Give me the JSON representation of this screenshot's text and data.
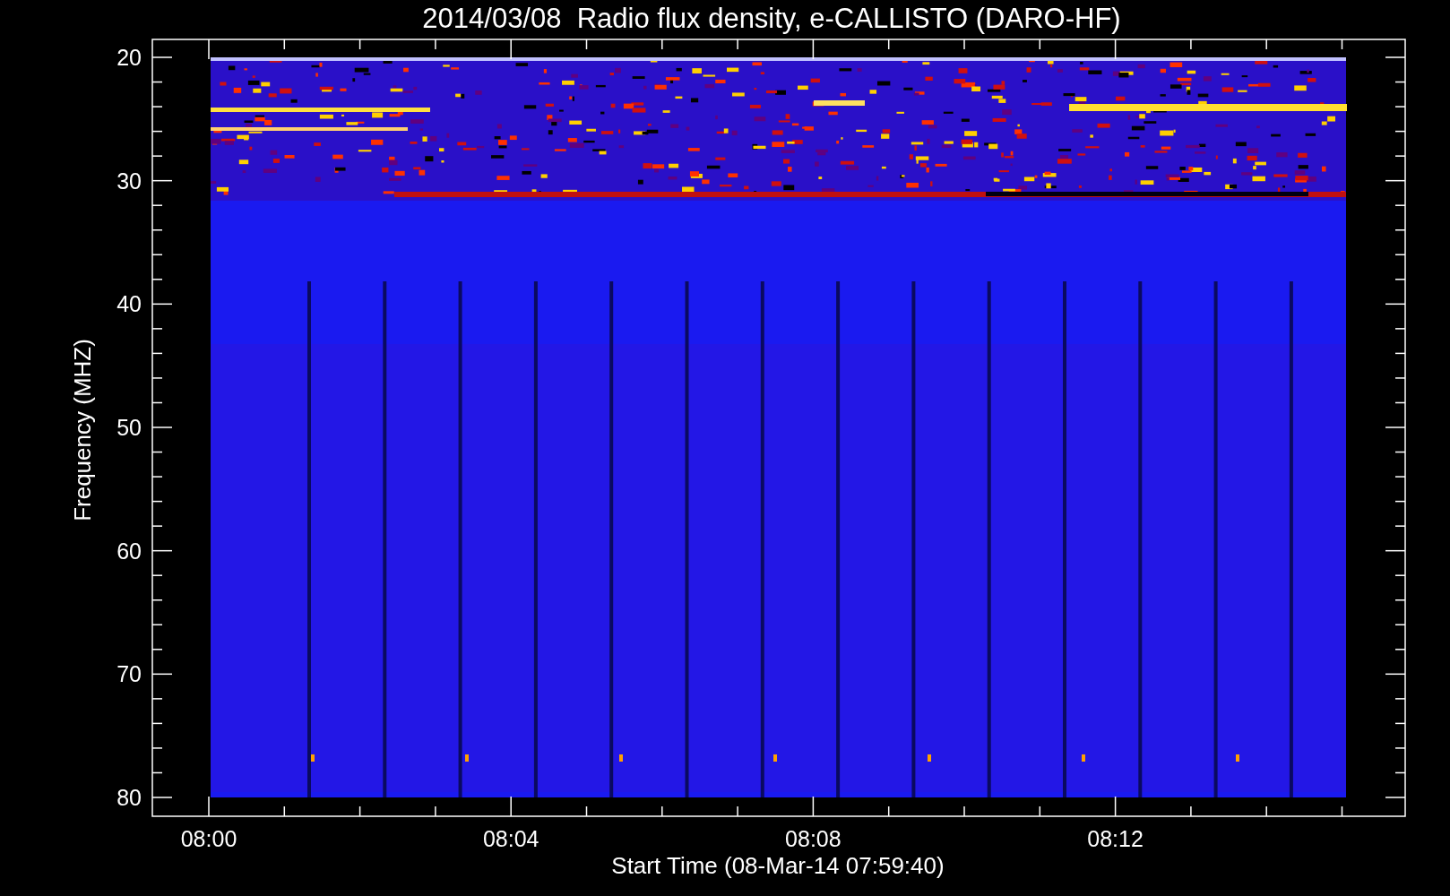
{
  "title": "2014/03/08  Radio flux density, e-CALLISTO (DARO-HF)",
  "plot": {
    "ylabel": "Frequency (MHZ)",
    "xlabel": "Start Time (08-Mar-14 07:59:40)",
    "yticks": [
      "20",
      "30",
      "40",
      "50",
      "60",
      "70",
      "80"
    ],
    "xticks": [
      "08:00",
      "08:04",
      "08:08",
      "08:12"
    ]
  }
}
